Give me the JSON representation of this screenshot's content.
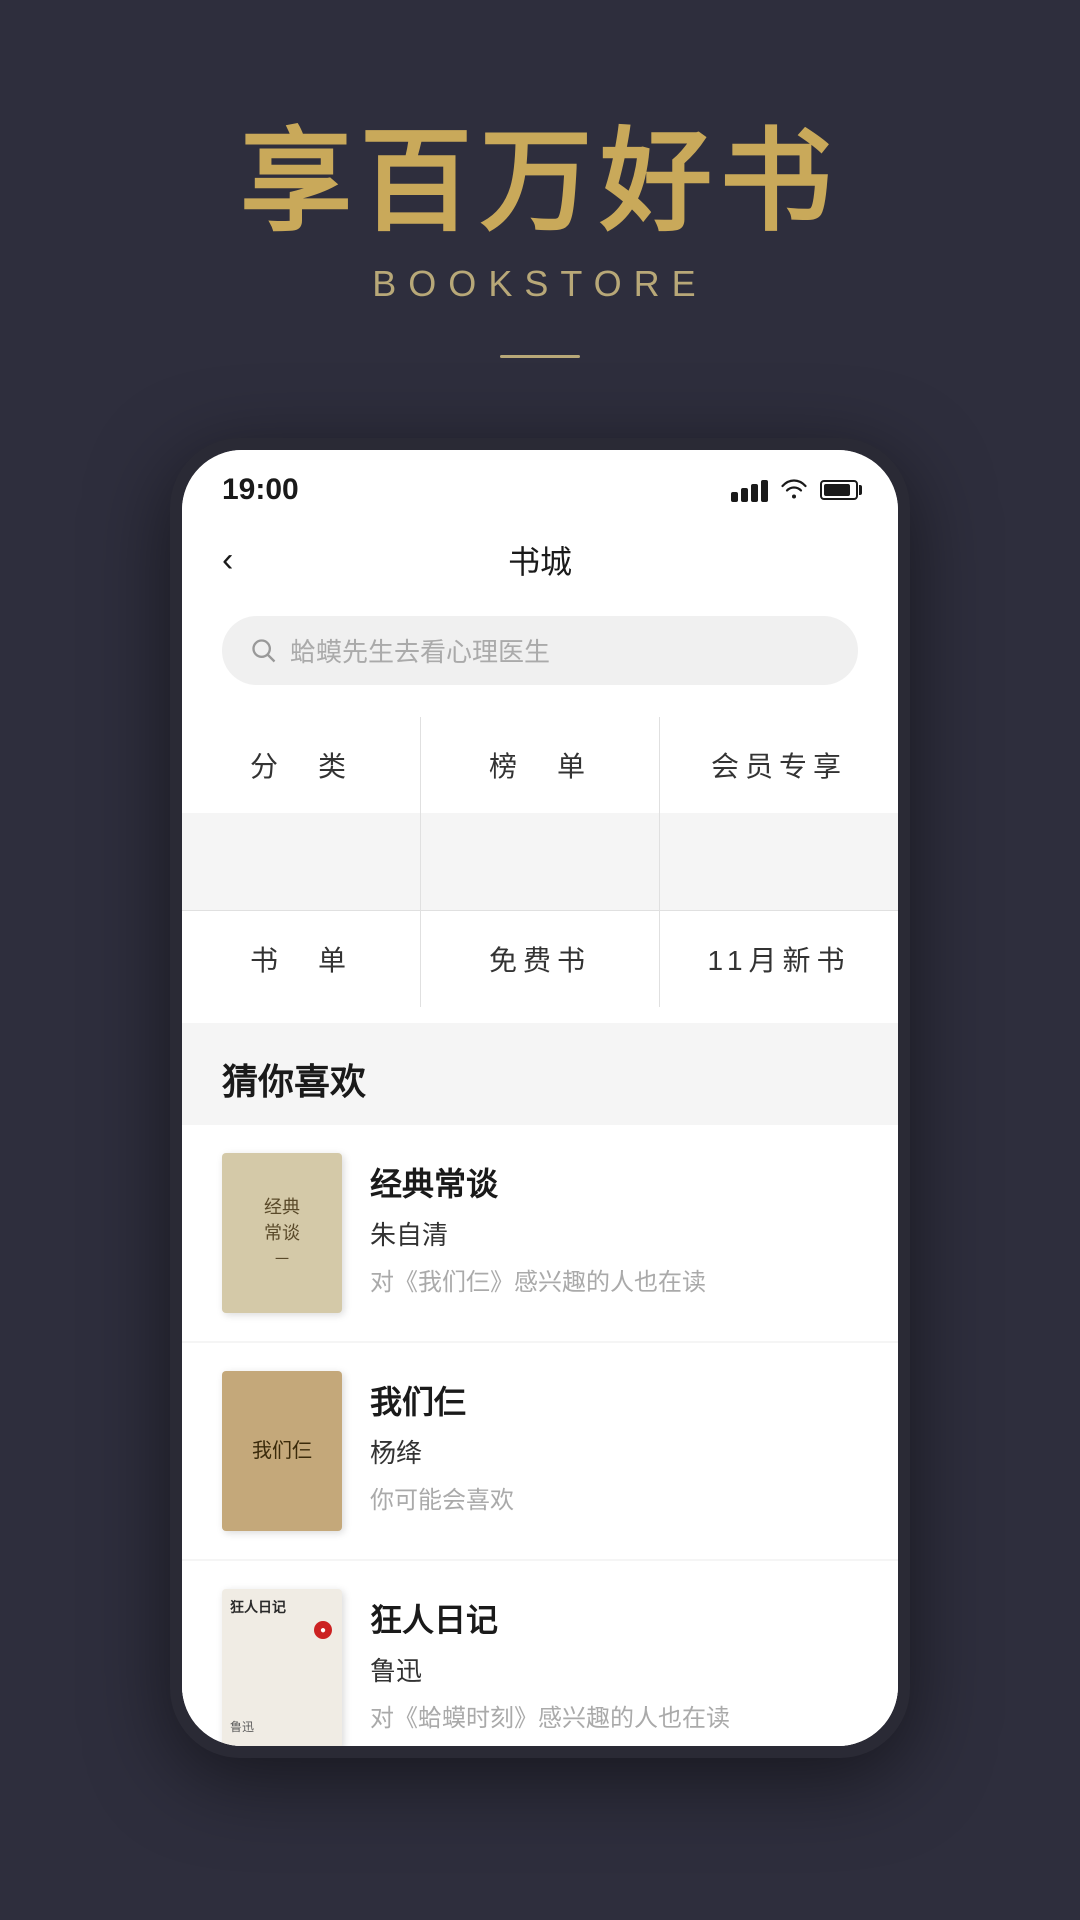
{
  "background": {
    "color": "#2e2e3d"
  },
  "header": {
    "main_title": "享百万好书",
    "subtitle": "BOOKSTORE"
  },
  "status_bar": {
    "time": "19:00"
  },
  "nav": {
    "back_label": "‹",
    "title": "书城"
  },
  "search": {
    "placeholder": "蛤蟆先生去看心理医生"
  },
  "categories": [
    {
      "id": "fenlei",
      "label": "分　类"
    },
    {
      "id": "bangdan",
      "label": "榜　单"
    },
    {
      "id": "huiyuan",
      "label": "会员专享"
    },
    {
      "id": "shudan",
      "label": "书　单"
    },
    {
      "id": "mianfei",
      "label": "免费书"
    },
    {
      "id": "xinshu",
      "label": "11月新书"
    }
  ],
  "recommendations": {
    "section_title": "猜你喜欢",
    "books": [
      {
        "id": "book1",
        "title": "经典常谈",
        "author": "朱自清",
        "desc": "对《我们仨》感兴趣的人也在读",
        "cover_text": "经典\n常谈\n一"
      },
      {
        "id": "book2",
        "title": "我们仨",
        "author": "杨绛",
        "desc": "你可能会喜欢",
        "cover_text": "我们仨"
      },
      {
        "id": "book3",
        "title": "狂人日记",
        "author": "鲁迅",
        "desc": "对《蛤蟆时刻》感兴趣的人也在读",
        "cover_text": "狂人日记"
      }
    ]
  }
}
